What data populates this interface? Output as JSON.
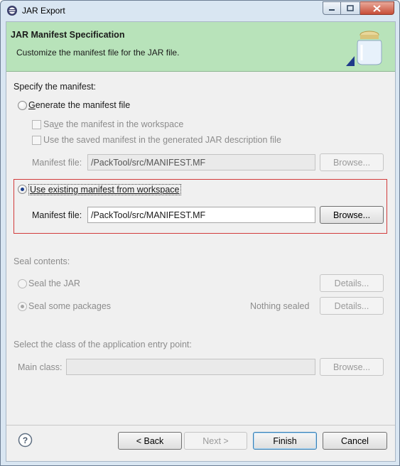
{
  "window": {
    "title": "JAR Export"
  },
  "header": {
    "title": "JAR Manifest Specification",
    "description": "Customize the manifest file for the JAR file."
  },
  "specify_label": "Specify the manifest:",
  "generate": {
    "label_pre": "",
    "label_key": "G",
    "label_post": "enerate the manifest file",
    "save_pre": "Sa",
    "save_key": "v",
    "save_post": "e the manifest in the workspace",
    "use_saved": "Use the saved manifest in the generated JAR description file",
    "manifest_label": "Manifest file:",
    "manifest_value": "/PackTool/src/MANIFEST.MF",
    "browse": "Browse..."
  },
  "existing": {
    "label": "Use existing manifest from workspace",
    "manifest_label": "Manifest file:",
    "manifest_value": "/PackTool/src/MANIFEST.MF",
    "browse": "Browse..."
  },
  "seal": {
    "heading": "Seal contents:",
    "seal_jar": "Seal the JAR",
    "seal_packages": "Seal some packages",
    "nothing_sealed": "Nothing sealed",
    "details": "Details..."
  },
  "entry": {
    "heading": "Select the class of the application entry point:",
    "main_class_label": "Main class:",
    "main_class_value": "",
    "browse": "Browse..."
  },
  "buttons": {
    "back": "< Back",
    "next": "Next >",
    "finish": "Finish",
    "cancel": "Cancel"
  }
}
